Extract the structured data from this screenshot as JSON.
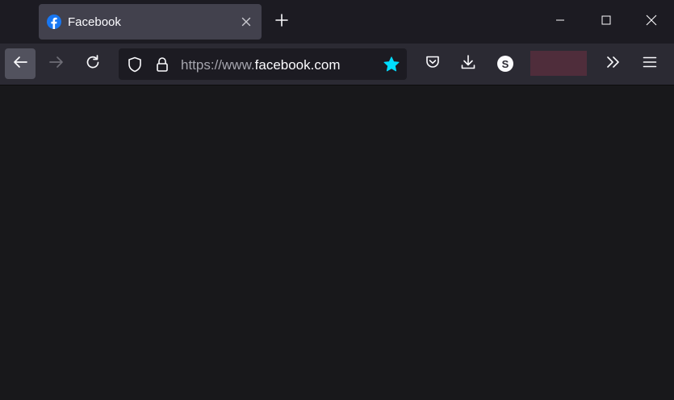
{
  "tab": {
    "title": "Facebook",
    "favicon": "facebook-icon",
    "close_icon": "close-icon"
  },
  "new_tab_icon": "plus-icon",
  "window_controls": {
    "minimize_icon": "minimize-icon",
    "maximize_icon": "maximize-icon",
    "close_icon": "close-icon"
  },
  "toolbar": {
    "back_icon": "arrow-left-icon",
    "forward_icon": "arrow-right-icon",
    "reload_icon": "reload-icon",
    "pocket_icon": "pocket-icon",
    "download_icon": "download-icon",
    "account_initial": "S",
    "overflow_icon": "chevron-double-right-icon",
    "menu_icon": "hamburger-menu-icon"
  },
  "urlbar": {
    "prefix": "https://www.",
    "domain": "facebook.com",
    "shield_icon": "shield-icon",
    "lock_icon": "lock-icon",
    "star_icon": "star-icon"
  },
  "colors": {
    "tabbar_bg": "#1c1b22",
    "active_tab_bg": "#42414d",
    "toolbar_bg": "#2b2a33",
    "content_bg": "#18181b",
    "star_color": "#00ddff",
    "facebook_blue": "#1877f2",
    "extension_swatch": "#4f2d3b"
  }
}
